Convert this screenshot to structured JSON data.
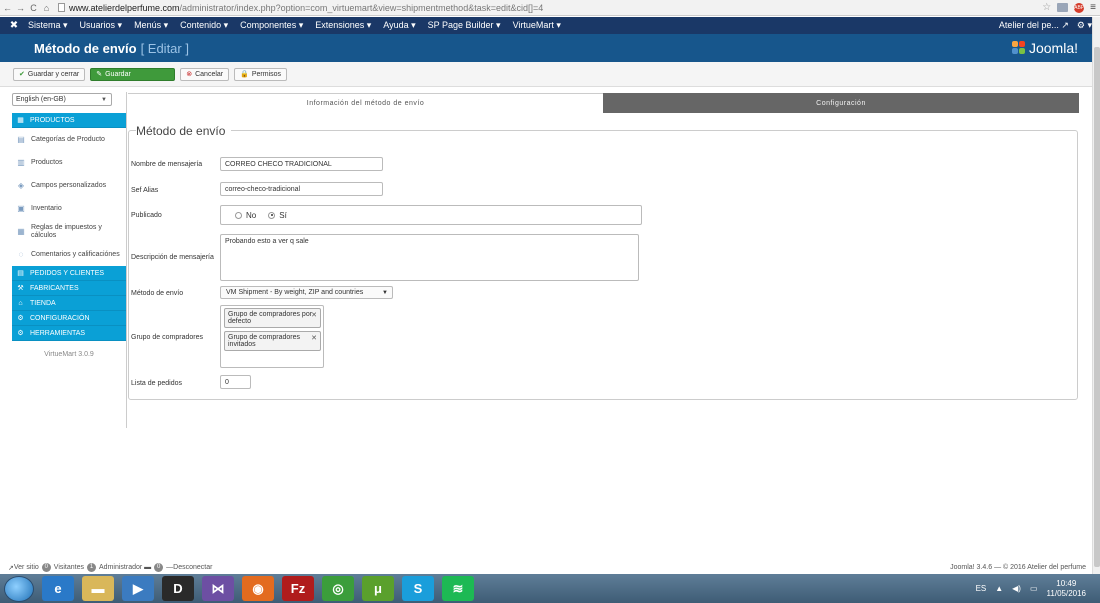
{
  "browser": {
    "url_host": "www.atelierdelperfume.com",
    "url_path": "/administrator/index.php?option=com_virtuemart&view=shipmentmethod&task=edit&cid[]=4"
  },
  "topnav": {
    "items": [
      "Sistema ▾",
      "Usuarios ▾",
      "Menús ▾",
      "Contenido ▾",
      "Componentes ▾",
      "Extensiones ▾",
      "Ayuda ▾",
      "SP Page Builder ▾",
      "VirtueMart ▾"
    ],
    "site_link": "Atelier del pe... ↗",
    "settings": "⚙ ▾"
  },
  "header": {
    "title": "Método de envío",
    "subtitle": "[ Editar ]",
    "brand": "Joomla!"
  },
  "toolbar": {
    "save_close": "Guardar y cerrar",
    "save": "Guardar",
    "cancel": "Cancelar",
    "permissions": "Permisos"
  },
  "language": {
    "selected": "English (en-GB)"
  },
  "sidebar": {
    "products_header": "PRODUCTOS",
    "items": [
      "Categorías de Producto",
      "Productos",
      "Campos personalizados",
      "Inventario",
      "Reglas de impuestos y cálculos",
      "Comentarios y calificaciónes"
    ],
    "sections": [
      "PEDIDOS Y CLIENTES",
      "FABRICANTES",
      "TIENDA",
      "CONFIGURACIÓN",
      "HERRAMIENTAS"
    ],
    "version": "VirtueMart 3.0.9"
  },
  "tabs": {
    "info": "Información del método de envío",
    "config": "Configuración"
  },
  "form": {
    "legend": "Método de envío",
    "name_label": "Nombre de mensajería",
    "name_value": "CORREO CHECO TRADICIONAL",
    "alias_label": "Sef Alias",
    "alias_value": "correo-checo-tradicional",
    "published_label": "Publicado",
    "published_no": "No",
    "published_yes": "Sí",
    "published": "Sí",
    "description_label": "Descripción de mensajería",
    "description_value": "Probando esto a ver q sale",
    "method_label": "Método de envío",
    "method_value": "VM Shipment - By weight, ZIP and countries",
    "groups_label": "Grupo de compradores",
    "groups": [
      "Grupo de compradores por defecto",
      "Grupo de compradores invitados"
    ],
    "order_label": "Lista de pedidos",
    "order_value": "0"
  },
  "status": {
    "view_site": "Ver sitio",
    "visitors_count": "0",
    "visitors": "Visitantes",
    "admins_count": "1",
    "admins": "Administrador",
    "messages_count": "0",
    "logout": "Desconectar",
    "footer": "Joomla! 3.4.6 — © 2016 Atelier del perfume"
  },
  "taskbar": {
    "lang": "ES",
    "time": "10:49",
    "date": "11/05/2016"
  },
  "colors": {
    "topnav": "#1a3867",
    "titlebar": "#17568c",
    "save_green": "#3f9a3b",
    "sidebar_blue": "#0aa0d6",
    "config_tab": "#666666"
  }
}
